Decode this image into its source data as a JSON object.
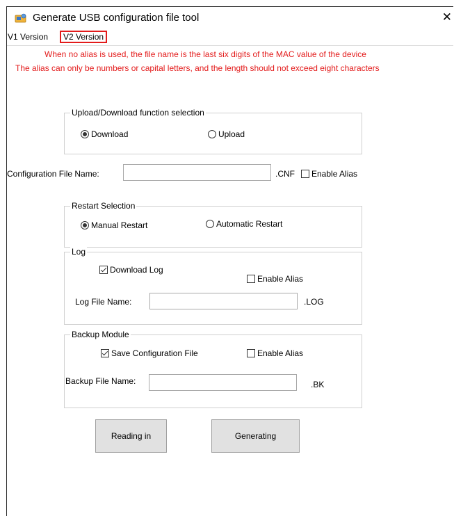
{
  "window": {
    "title": "Generate USB configuration file tool",
    "close": "✕"
  },
  "tabs": [
    {
      "label": "V1 Version"
    },
    {
      "label": "V2 Version"
    }
  ],
  "notices": [
    "When no alias is used, the file name is the last six digits of the MAC value of the device",
    "The alias can only be numbers or capital letters, and the length should not exceed eight characters"
  ],
  "upload_group": {
    "legend": "Upload/Download function selection",
    "download": "Download",
    "upload": "Upload",
    "selected": "download"
  },
  "config": {
    "label": "Configuration File Name:",
    "value": "",
    "ext": ".CNF",
    "alias_label": "Enable Alias",
    "alias_checked": false
  },
  "restart_group": {
    "legend": "Restart Selection",
    "manual": "Manual Restart",
    "automatic": "Automatic Restart",
    "selected": "manual"
  },
  "log_group": {
    "legend": "Log",
    "download_log": "Download Log",
    "download_log_checked": true,
    "alias_label": "Enable Alias",
    "alias_checked": false,
    "file_label": "Log File Name:",
    "value": "",
    "ext": ".LOG"
  },
  "backup_group": {
    "legend": "Backup Module",
    "save_config": "Save Configuration File",
    "save_config_checked": true,
    "alias_label": "Enable Alias",
    "alias_checked": false,
    "file_label": "Backup File Name:",
    "value": "",
    "ext": ".BK"
  },
  "buttons": {
    "read": "Reading in",
    "generate": "Generating"
  },
  "colors": {
    "notice": "#e31c1c",
    "tab_highlight": "#e31c1c",
    "button_bg": "#e1e1e1"
  }
}
